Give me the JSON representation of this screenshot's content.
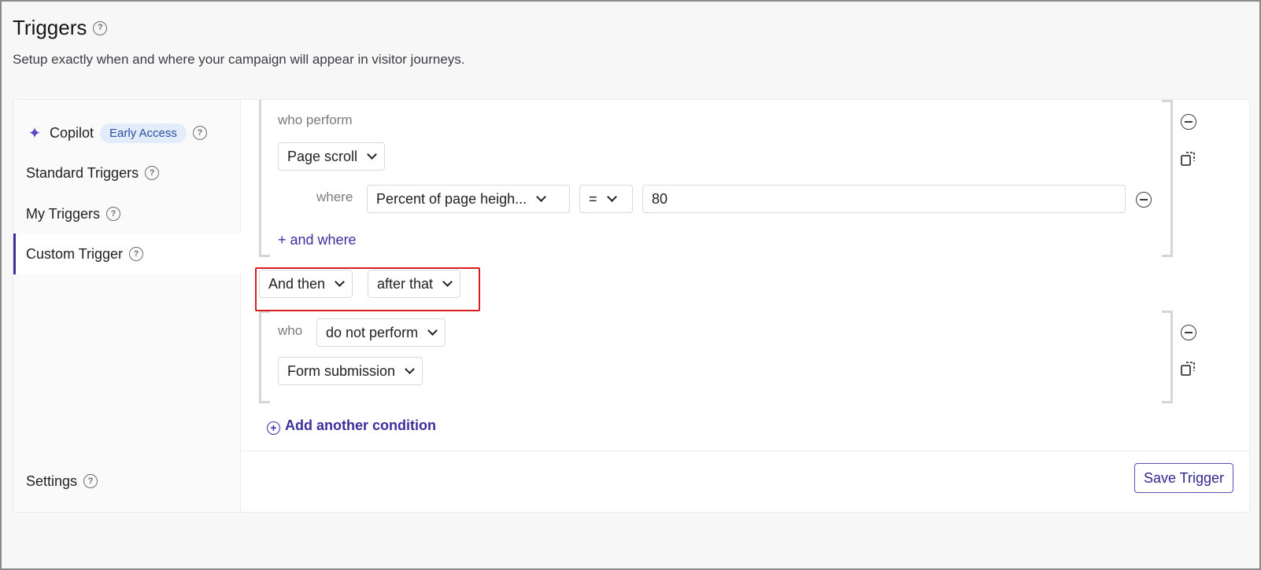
{
  "header": {
    "title": "Triggers",
    "subtitle": "Setup exactly when and where your campaign will appear in visitor journeys."
  },
  "sidebar": {
    "items": [
      {
        "label": "Copilot",
        "badge": "Early Access",
        "icon": "sparkle-icon"
      },
      {
        "label": "Standard Triggers"
      },
      {
        "label": "My Triggers"
      },
      {
        "label": "Custom Trigger",
        "active": true
      },
      {
        "label": "Settings"
      }
    ]
  },
  "condition1": {
    "lead": "who perform",
    "event": "Page scroll",
    "where_label": "where",
    "property": "Percent of page heigh...",
    "operator": "=",
    "value": "80",
    "add_where": "+ and where"
  },
  "connector": {
    "logic": "And then",
    "timing": "after that"
  },
  "condition2": {
    "lead": "who",
    "action": "do not perform",
    "event": "Form submission"
  },
  "actions": {
    "add_condition": "Add another condition",
    "save": "Save Trigger"
  },
  "colors": {
    "accent": "#3b2f9e",
    "highlight": "#d81e1e",
    "badge_bg": "#e2ecfb"
  }
}
